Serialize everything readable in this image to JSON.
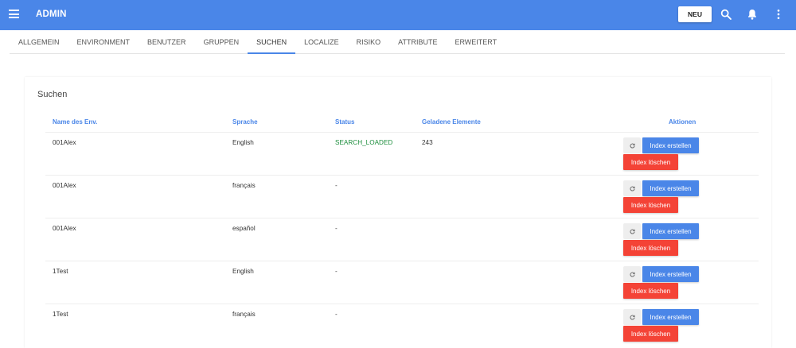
{
  "app": {
    "title": "ADMIN",
    "new_button": "NEU"
  },
  "icons": {
    "menu": "menu-icon",
    "search": "search-icon",
    "notifications": "bell-icon",
    "more": "more-vert-icon",
    "refresh": "refresh-icon"
  },
  "colors": {
    "primary": "#4a86e8",
    "danger": "#f44336",
    "success": "#1e8e3e"
  },
  "tabs": [
    {
      "label": "ALLGEMEIN",
      "active": false
    },
    {
      "label": "ENVIRONMENT",
      "active": false
    },
    {
      "label": "BENUTZER",
      "active": false
    },
    {
      "label": "GRUPPEN",
      "active": false
    },
    {
      "label": "SUCHEN",
      "active": true
    },
    {
      "label": "LOCALIZE",
      "active": false
    },
    {
      "label": "RISIKO",
      "active": false
    },
    {
      "label": "ATTRIBUTE",
      "active": false
    },
    {
      "label": "ERWEITERT",
      "active": false
    }
  ],
  "search_section": {
    "title": "Suchen",
    "columns": {
      "env_name": "Name des Env.",
      "language": "Sprache",
      "status": "Status",
      "loaded": "Geladene Elemente",
      "actions": "Aktionen"
    },
    "rows": [
      {
        "env": "001Alex",
        "language": "English",
        "status": "SEARCH_LOADED",
        "loaded": "243"
      },
      {
        "env": "001Alex",
        "language": "français",
        "status": "-",
        "loaded": ""
      },
      {
        "env": "001Alex",
        "language": "español",
        "status": "-",
        "loaded": ""
      },
      {
        "env": "1Test",
        "language": "English",
        "status": "-",
        "loaded": ""
      },
      {
        "env": "1Test",
        "language": "français",
        "status": "-",
        "loaded": ""
      }
    ],
    "actions": {
      "create_index": "Index erstellen",
      "delete_index": "Index löschen"
    }
  }
}
